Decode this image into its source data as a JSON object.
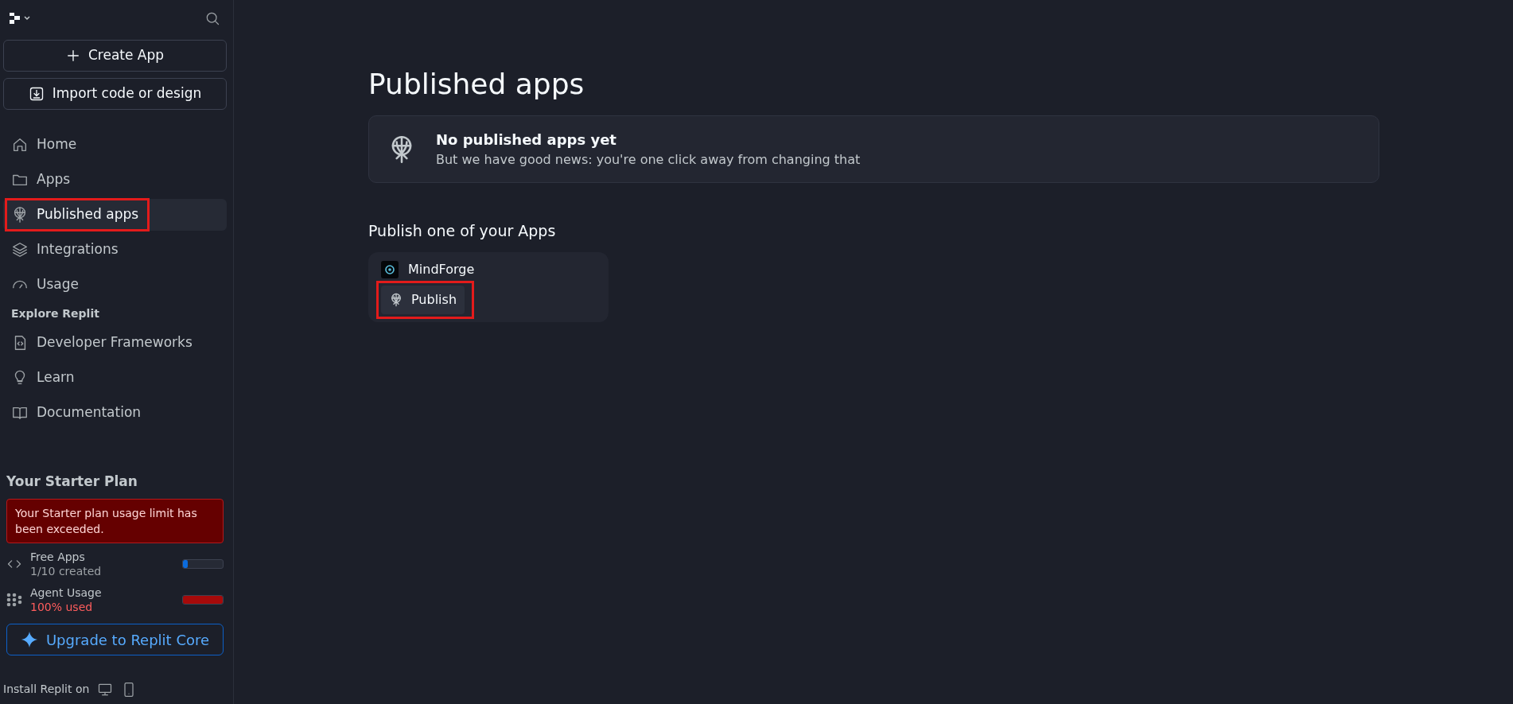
{
  "sidebar": {
    "create_button": "Create App",
    "import_button": "Import code or design",
    "nav_items": [
      {
        "label": "Home",
        "selected": false,
        "highlighted": false
      },
      {
        "label": "Apps",
        "selected": false,
        "highlighted": false
      },
      {
        "label": "Published apps",
        "selected": true,
        "highlighted": true
      },
      {
        "label": "Integrations",
        "selected": false,
        "highlighted": false
      },
      {
        "label": "Usage",
        "selected": false,
        "highlighted": false
      }
    ],
    "explore_heading": "Explore Replit",
    "explore_items": [
      {
        "label": "Developer Frameworks"
      },
      {
        "label": "Learn"
      },
      {
        "label": "Documentation"
      }
    ],
    "plan": {
      "title": "Your Starter Plan",
      "alert": "Your Starter plan usage limit has been exceeded.",
      "usage": [
        {
          "name": "Free Apps",
          "detail": "1/10 created",
          "level": 0.1,
          "exceeded": false
        },
        {
          "name": "Agent Usage",
          "detail": "100% used",
          "level": 1.0,
          "exceeded": true
        }
      ],
      "upgrade_button": "Upgrade to Replit Core"
    },
    "install_label": "Install Replit on"
  },
  "main": {
    "title": "Published apps",
    "empty_state": {
      "title": "No published apps yet",
      "text": "But we have good news: you're one click away from changing that"
    },
    "section_title": "Publish one of your Apps",
    "apps": [
      {
        "name": "MindForge",
        "publish_button": "Publish",
        "highlighted": true
      }
    ]
  }
}
